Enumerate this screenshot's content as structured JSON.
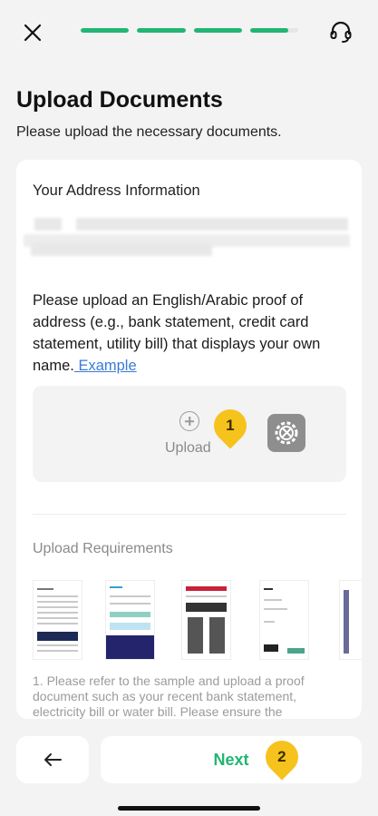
{
  "header": {
    "close_icon": "close-icon",
    "support_icon": "headset-icon",
    "progress_steps": [
      1,
      1,
      1,
      0.8
    ],
    "accent_color": "#22b573"
  },
  "page": {
    "title": "Upload Documents",
    "subtitle": "Please upload the necessary documents."
  },
  "address_card": {
    "heading": "Your Address Information",
    "instructions": "Please upload an English/Arabic proof of address (e.g., bank statement, credit card statement, utility bill) that displays your own name.",
    "example_link": " Example",
    "upload_label": "Upload",
    "upload_icon": "plus-circle-icon",
    "tool_icon": "gear-wrench-icon",
    "badge_1": "1"
  },
  "requirements": {
    "heading": "Upload Requirements",
    "text": "1. Please refer to the sample and upload a proof document such as your recent bank statement, electricity bill or water bill. Please ensure the"
  },
  "footer": {
    "back_icon": "arrow-left-icon",
    "next_label": "Next",
    "badge_2": "2"
  }
}
